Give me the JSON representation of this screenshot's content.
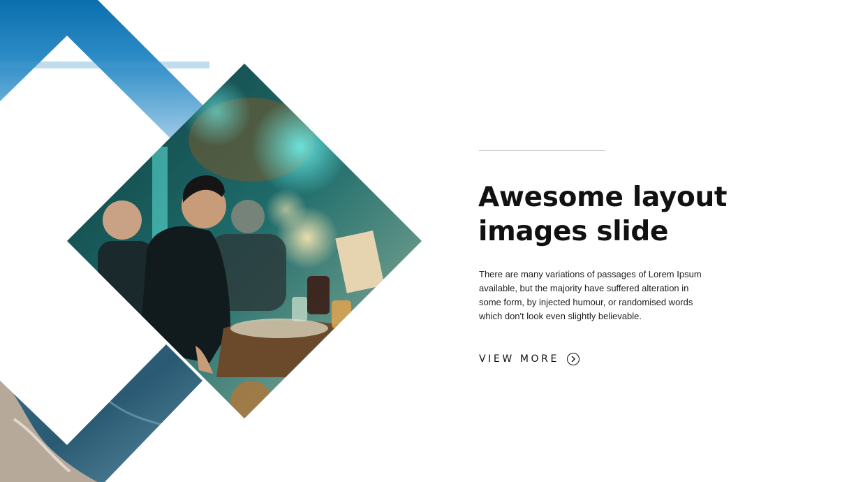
{
  "slide": {
    "title_lines": [
      "Awesome layout",
      "images slide"
    ],
    "body_lines": [
      "There are many variations of passages of Lorem Ipsum",
      "available, but the majority have suffered alteration in",
      "some form, by injected humour, or randomised words",
      "which don't look even slightly believable."
    ],
    "cta_label": "VIEW MORE",
    "cta_icon": "chevron-right-circle-icon"
  },
  "colors": {
    "background": "#ffffff",
    "text": "#111111",
    "divider": "#cfcfcf",
    "sky_top": "#0a73b0",
    "teal_glow": "#3fd6d0"
  }
}
